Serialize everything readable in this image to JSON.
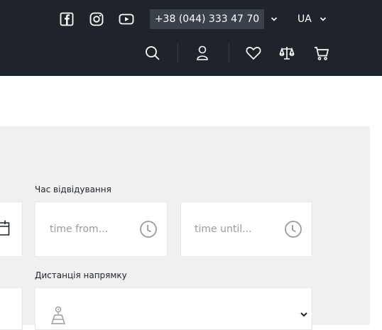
{
  "header": {
    "phone": "+38 (044) 333 47 70",
    "language": "UA",
    "social_icons": [
      "facebook-icon",
      "instagram-icon",
      "youtube-icon"
    ],
    "tool_icons": [
      "search-icon",
      "user-icon",
      "heart-icon",
      "scales-icon",
      "cart-icon"
    ]
  },
  "form": {
    "visit_time_label": "Час відвідування",
    "time_from_placeholder": "time from...",
    "time_until_placeholder": "time until...",
    "direction_distance_label": "Дистанція напрямку"
  },
  "colors": {
    "header_bg": "#1f242b",
    "phone_bg": "#3a414b",
    "panel_bg": "#f0f0f0",
    "placeholder": "#9a9a9a"
  }
}
